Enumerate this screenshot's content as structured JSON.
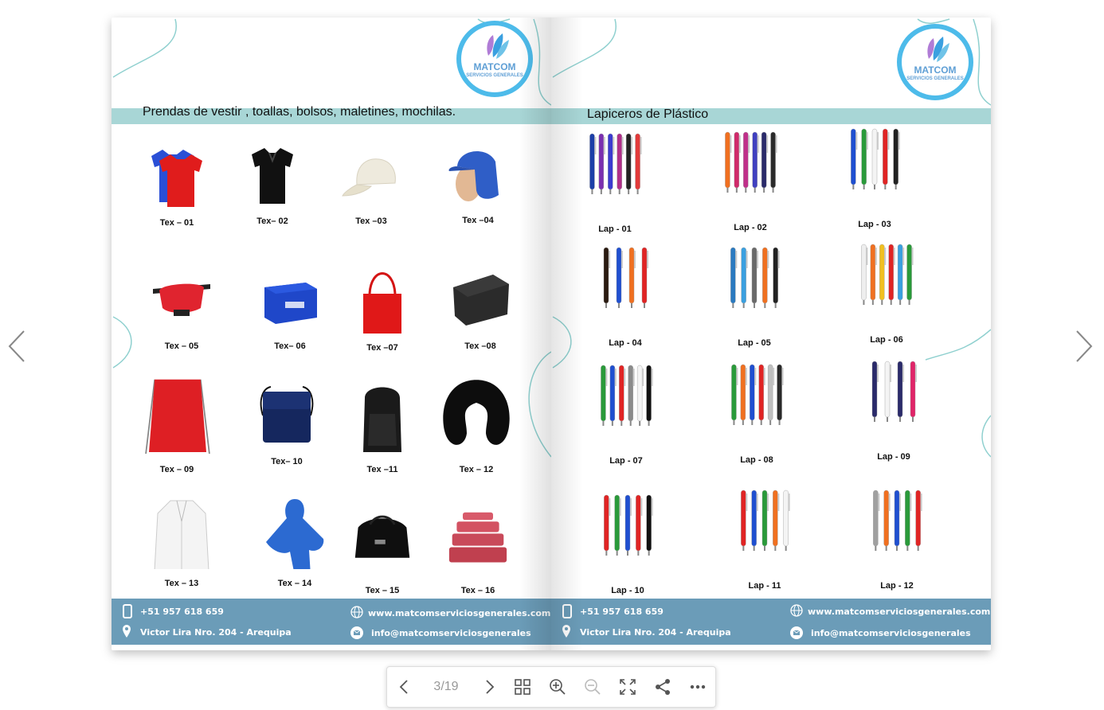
{
  "viewer": {
    "page_indicator": "3/19",
    "icons": [
      "chevron-left-icon",
      "chevron-right-icon",
      "grid-icon",
      "zoom-in-icon",
      "zoom-out-icon",
      "fullscreen-icon",
      "share-icon",
      "more-icon"
    ]
  },
  "left_page": {
    "logo": {
      "name": "MATCOM",
      "sub": "SERVICIOS GENERALES"
    },
    "title": "Prendas de vestir , toallas, bolsos, maletines, mochilas.",
    "items": [
      {
        "code": "Tex – 01",
        "icon": "tshirt-icon"
      },
      {
        "code": "Tex– 02",
        "icon": "polo-icon"
      },
      {
        "code": "Tex –03",
        "icon": "cap-icon"
      },
      {
        "code": "Tex –04",
        "icon": "legionnaire-cap-icon"
      },
      {
        "code": "Tex – 05",
        "icon": "waist-bag-icon"
      },
      {
        "code": "Tex– 06",
        "icon": "cooler-bag-icon"
      },
      {
        "code": "Tex –07",
        "icon": "tote-bag-icon"
      },
      {
        "code": "Tex –08",
        "icon": "briefcase-icon"
      },
      {
        "code": "Tex – 09",
        "icon": "drawstring-bag-icon"
      },
      {
        "code": "Tex– 10",
        "icon": "shoulder-bag-icon"
      },
      {
        "code": "Tex –11",
        "icon": "backpack-icon"
      },
      {
        "code": "Tex – 12",
        "icon": "neck-pillow-icon"
      },
      {
        "code": "Tex – 13",
        "icon": "lab-coat-icon"
      },
      {
        "code": "Tex – 14",
        "icon": "poncho-icon"
      },
      {
        "code": "Tex – 15",
        "icon": "duffel-bag-icon"
      },
      {
        "code": "Tex – 16",
        "icon": "towels-icon"
      }
    ],
    "footer": {
      "phone": "+51 957 618 659",
      "address": "Victor Lira Nro. 204 - Arequipa",
      "web": "www.matcomserviciosgenerales.com",
      "email": "info@matcomserviciosgenerales"
    }
  },
  "right_page": {
    "logo": {
      "name": "MATCOM",
      "sub": "SERVICIOS GENERALES"
    },
    "title": "Lapiceros de Plástico",
    "items": [
      {
        "code": "Lap - 01"
      },
      {
        "code": "Lap - 02"
      },
      {
        "code": "Lap - 03"
      },
      {
        "code": "Lap - 04"
      },
      {
        "code": "Lap - 05"
      },
      {
        "code": "Lap - 06"
      },
      {
        "code": "Lap - 07"
      },
      {
        "code": "Lap - 08"
      },
      {
        "code": "Lap - 09"
      },
      {
        "code": "Lap - 10"
      },
      {
        "code": "Lap - 11"
      },
      {
        "code": "Lap - 12"
      }
    ],
    "footer": {
      "phone": "+51 957 618 659",
      "address": "Victor Lira Nro. 204 - Arequipa",
      "web": "www.matcomserviciosgenerales.com",
      "email": "info@matcomserviciosgenerales"
    }
  },
  "colors": {
    "band": "#a8d6d6",
    "footer": "#6b9cb8",
    "logo_ring": "#4dbbea",
    "deco_line": "#8fd0cf"
  }
}
